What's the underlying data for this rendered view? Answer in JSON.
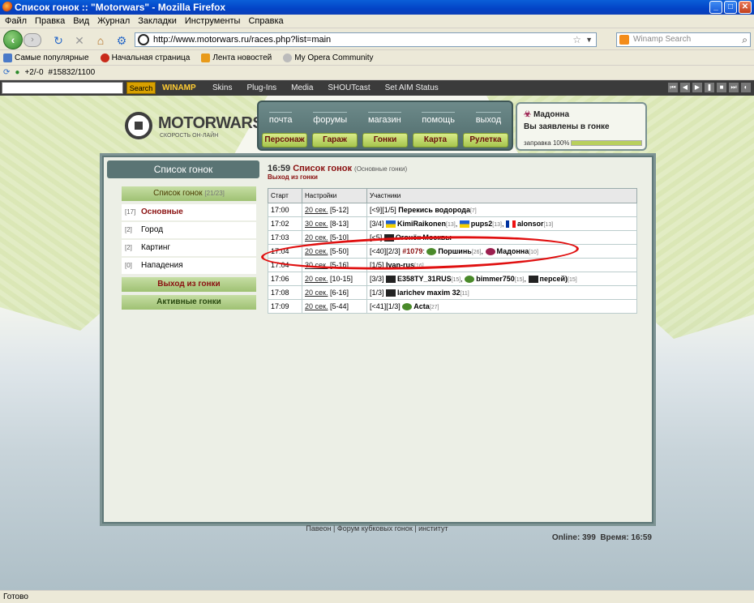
{
  "window": {
    "title": "Список гонок :: \"Motorwars\" - Mozilla Firefox"
  },
  "menubar": [
    "Файл",
    "Правка",
    "Вид",
    "Журнал",
    "Закладки",
    "Инструменты",
    "Справка"
  ],
  "navbar": {
    "url": "http://www.motorwars.ru/races.php?list=main",
    "search_placeholder": "Winamp Search"
  },
  "bookmarks": [
    "Самые популярные",
    "Начальная страница",
    "Лента новостей",
    "My Opera Community"
  ],
  "addonbar": {
    "score": "+2/-0",
    "counter": "#15832/1100"
  },
  "winamp": {
    "search_button": "Search",
    "logo": "WINAMP",
    "menus": [
      "Skins",
      "Plug-Ins",
      "Media",
      "SHOUTcast",
      "Set AIM Status"
    ]
  },
  "site": {
    "logo_text": "MOTORWARS.RU",
    "logo_sub": "СКОРОСТЬ ОН-ЛАЙН",
    "top_links": [
      "почта",
      "форумы",
      "магазин",
      "помощь",
      "выход"
    ],
    "top_buttons": [
      "Персонаж",
      "Гараж",
      "Гонки",
      "Карта",
      "Рулетка"
    ],
    "user": {
      "name": "Мадонна",
      "status": "Вы заявлены в гонке",
      "fuel_label": "заправка 100%",
      "fuel": 1.0
    }
  },
  "left_panel": {
    "heading": "Список гонок",
    "title": "Список гонок",
    "title_count": "[21/23]",
    "items": [
      {
        "count": "[17]",
        "label": "Основные"
      },
      {
        "count": "[2]",
        "label": "Город"
      },
      {
        "count": "[2]",
        "label": "Картинг"
      },
      {
        "count": "[0]",
        "label": "Нападения"
      }
    ],
    "exit_label": "Выход из гонки",
    "active_label": "Активные гонки"
  },
  "main": {
    "time": "16:59",
    "title": "Список гонок",
    "subtitle": "(Основные гонки)",
    "exit_link": "Выход из гонки",
    "table_headers": [
      "Старт",
      "Настройки",
      "Участники"
    ],
    "rows": [
      {
        "start": "17:00",
        "setting": "20 сек.",
        "range": "[5-12]",
        "prefix": "[<9][1/5]",
        "participants": [
          {
            "name": "Перекись водорода",
            "lvl": "[7]",
            "icon": ""
          }
        ]
      },
      {
        "start": "17:02",
        "setting": "30 сек.",
        "range": "[8-13]",
        "prefix": "[3/4]",
        "participants": [
          {
            "name": "KimiRaikonen",
            "lvl": "[13]",
            "icon": "ua"
          },
          {
            "name": "pups2",
            "lvl": "[13]",
            "icon": "ua"
          },
          {
            "name": "alonsor",
            "lvl": "[13]",
            "icon": "fr"
          }
        ]
      },
      {
        "start": "17:03",
        "setting": "20 сек.",
        "range": "[5-10]",
        "prefix": "[<5]",
        "participants": [
          {
            "name": "Огонёк Москвы",
            "lvl": "",
            "icon": "blk"
          }
        ]
      },
      {
        "start": "17:04",
        "setting": "20 сек.",
        "range": "[5-50]",
        "prefix": "[<40][2/3]",
        "participants": [
          {
            "name": "#1079",
            "lvl": "",
            "icon": "team"
          },
          {
            "name": "Поршинь",
            "lvl": "[26]",
            "icon": "grn"
          },
          {
            "name": "Мадонна",
            "lvl": "[10]",
            "icon": "mad"
          }
        ]
      },
      {
        "start": "17:04",
        "setting": "30 сек.",
        "range": "[5-16]",
        "prefix": "[1/5]",
        "participants": [
          {
            "name": "Ivan-rus",
            "lvl": "[16]",
            "icon": ""
          }
        ]
      },
      {
        "start": "17:06",
        "setting": "20 сек.",
        "range": "[10-15]",
        "prefix": "[3/3]",
        "participants": [
          {
            "name": "E358TY_31RUS",
            "lvl": "[15]",
            "icon": "blk"
          },
          {
            "name": "bimmer750",
            "lvl": "[15]",
            "icon": "grn"
          },
          {
            "name": "персей)",
            "lvl": "[15]",
            "icon": "blk"
          }
        ]
      },
      {
        "start": "17:08",
        "setting": "20 сек.",
        "range": "[6-16]",
        "prefix": "[1/3]",
        "participants": [
          {
            "name": "larichev maxim 32",
            "lvl": "[11]",
            "icon": "blk"
          }
        ]
      },
      {
        "start": "17:09",
        "setting": "20 сек.",
        "range": "[5-44]",
        "prefix": "[<41][1/3]",
        "participants": [
          {
            "name": "Acta",
            "lvl": "[27]",
            "icon": "grn"
          }
        ]
      }
    ]
  },
  "footer": {
    "links": "Павеон | Форум кубковых гонок | институт",
    "online": "Online: 399",
    "time": "Время: 16:59"
  },
  "statusbar": "Готово"
}
